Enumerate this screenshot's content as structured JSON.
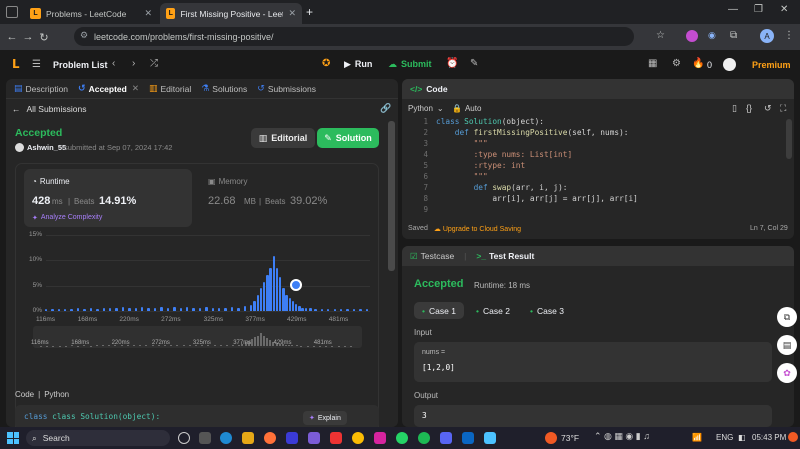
{
  "browser": {
    "tabs": [
      {
        "title": "Problems - LeetCode",
        "active": false
      },
      {
        "title": "First Missing Positive - LeetCod",
        "active": true
      }
    ],
    "url": "leetcode.com/problems/first-missing-positive/"
  },
  "topbar": {
    "problem_list": "Problem List",
    "run": "Run",
    "submit": "Submit",
    "streak": "0",
    "premium": "Premium"
  },
  "left": {
    "tabs": [
      "Description",
      "Accepted",
      "Editorial",
      "Solutions",
      "Submissions"
    ],
    "back": "All Submissions",
    "status": "Accepted",
    "user": "Ashwin_55",
    "submitted": "submitted at Sep 07, 2024 17:42",
    "editorial_btn": "Editorial",
    "solution_btn": "Solution",
    "runtime_label": "Runtime",
    "runtime_value": "428",
    "runtime_unit": "ms",
    "runtime_beats_label": "Beats",
    "runtime_beats": "14.91%",
    "analyze": "Analyze Complexity",
    "memory_label": "Memory",
    "memory_value": "22.68",
    "memory_unit": "MB",
    "memory_beats_label": "Beats",
    "memory_beats": "39.02%",
    "code_label": "Code",
    "code_lang": "Python",
    "code_preview": "class Solution(object):",
    "explain": "Explain"
  },
  "chart_data": {
    "type": "bar",
    "yticks": [
      "15%",
      "10%",
      "5%",
      "0%"
    ],
    "ylim": [
      0,
      15
    ],
    "xticks": [
      "116ms",
      "168ms",
      "220ms",
      "272ms",
      "325ms",
      "377ms",
      "429ms",
      "481ms"
    ],
    "x_start": 116,
    "x_end": 520,
    "series": [
      {
        "x": [
          116,
          124,
          132,
          140,
          148,
          156,
          164,
          172,
          180,
          188,
          196,
          204,
          212,
          220,
          228,
          236,
          244,
          252,
          260,
          268,
          276,
          284,
          292,
          300,
          308,
          316,
          324,
          332,
          340,
          348,
          356,
          364,
          372,
          376,
          380,
          384,
          388,
          392,
          396,
          400,
          404,
          408,
          412,
          416,
          420,
          424,
          428,
          432,
          436,
          440,
          446,
          452,
          460,
          468,
          476,
          484,
          492,
          500,
          508,
          516
        ],
        "values": [
          0.4,
          0.4,
          0.4,
          0.4,
          0.4,
          0.5,
          0.4,
          0.5,
          0.4,
          0.5,
          0.6,
          0.5,
          0.7,
          0.5,
          0.6,
          0.7,
          0.5,
          0.6,
          0.8,
          0.6,
          0.7,
          0.6,
          0.8,
          0.6,
          0.5,
          0.7,
          0.6,
          0.5,
          0.6,
          0.7,
          0.6,
          0.9,
          1.2,
          2.0,
          3.2,
          4.5,
          5.8,
          7.2,
          8.5,
          10.9,
          8.4,
          6.8,
          4.6,
          3.2,
          2.6,
          1.9,
          1.4,
          0.9,
          0.6,
          0.5,
          0.5,
          0.4,
          0.4,
          0.4,
          0.4,
          0.4,
          0.4,
          0.4,
          0.4,
          0.4
        ]
      }
    ],
    "highlight_x": 428,
    "highlight_y": 5.2
  },
  "editor": {
    "title": "Code",
    "lang": "Python",
    "mode": "Auto",
    "status_saved": "Saved",
    "upgrade": "Upgrade to Cloud Saving",
    "cursor": "Ln 7, Col 29",
    "lines": [
      {
        "n": "1",
        "text": "class Solution(object):"
      },
      {
        "n": "2",
        "text": "    def firstMissingPositive(self, nums):"
      },
      {
        "n": "3",
        "text": "        \"\"\""
      },
      {
        "n": "4",
        "text": "        :type nums: List[int]"
      },
      {
        "n": "5",
        "text": "        :rtype: int"
      },
      {
        "n": "6",
        "text": "        \"\"\""
      },
      {
        "n": "7",
        "text": "        def swap(arr, i, j):"
      },
      {
        "n": "8",
        "text": "            arr[i], arr[j] = arr[j], arr[i]"
      },
      {
        "n": "9",
        "text": ""
      }
    ]
  },
  "result": {
    "testcase_tab": "Testcase",
    "result_tab": "Test Result",
    "status": "Accepted",
    "runtime": "Runtime: 18 ms",
    "cases": [
      "Case 1",
      "Case 2",
      "Case 3"
    ],
    "input_label": "Input",
    "input_var": "nums =",
    "input_value": "[1,2,0]",
    "output_label": "Output",
    "output_value": "3"
  },
  "taskbar": {
    "search": "Search",
    "weather": "73°F",
    "lang": "ENG",
    "time": "05:43 PM"
  },
  "colors": {
    "accent": "#ffa116",
    "green": "#2cbb5d",
    "blue": "#3e7ff5"
  }
}
